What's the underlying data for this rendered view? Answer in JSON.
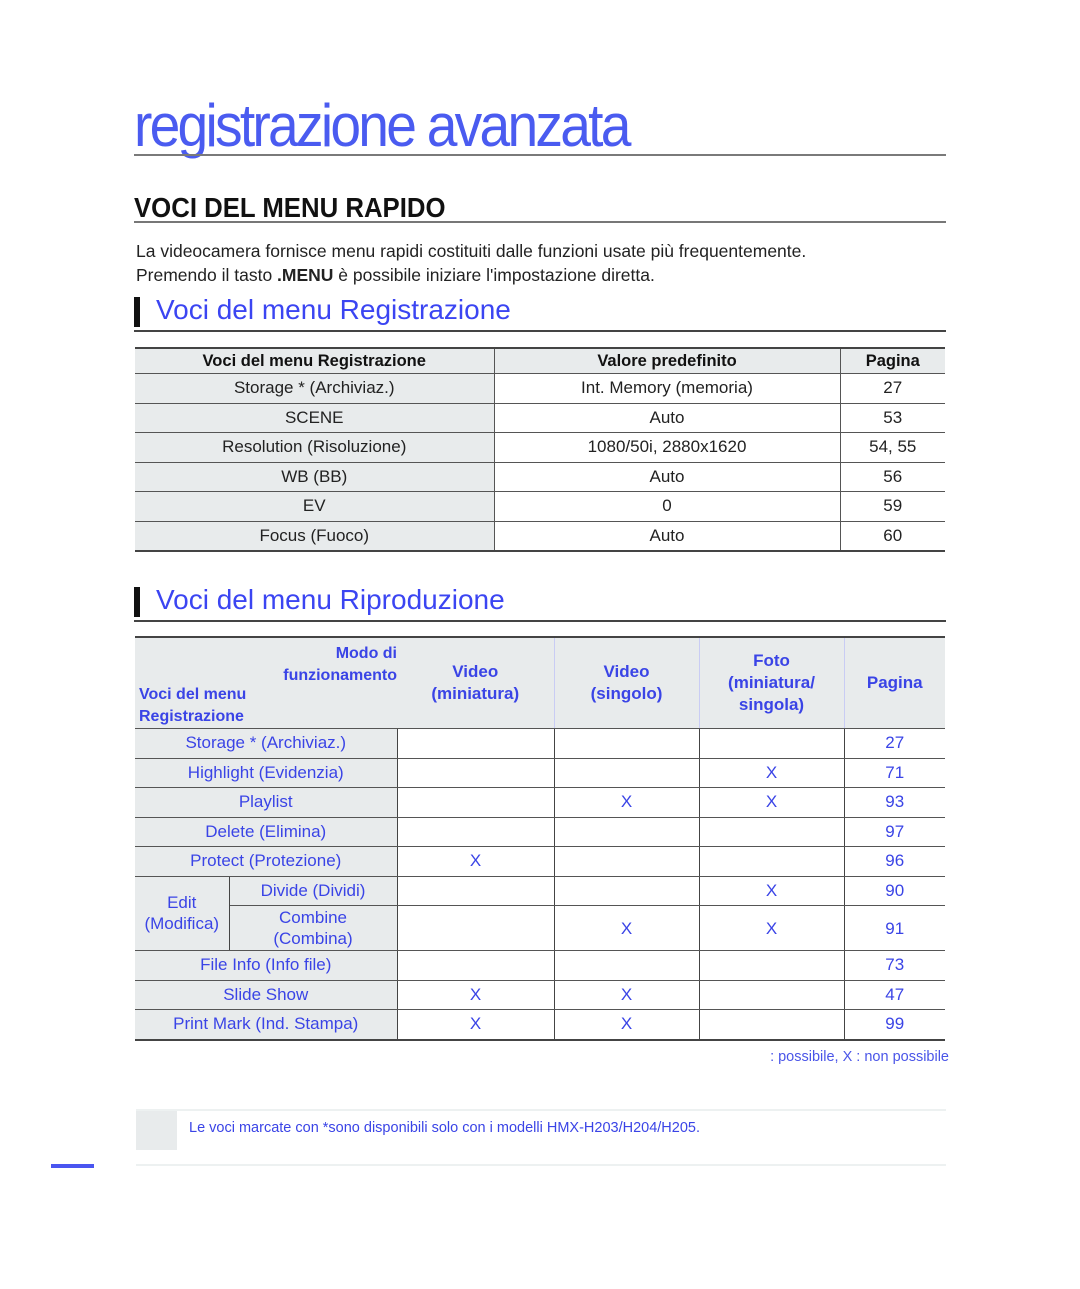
{
  "chapter_title": "registrazione avanzata",
  "section_title": "VOCI DEL MENU RAPIDO",
  "intro": {
    "line1": "La videocamera fornisce menu rapidi costituiti dalle funzioni usate più frequentemente.",
    "line2_pre": "Premendo il tasto ",
    "line2_key": ".MENU",
    "line2_post": " è possibile iniziare l'impostazione diretta."
  },
  "recording": {
    "heading": "Voci del menu Registrazione",
    "columns": [
      "Voci del menu Registrazione",
      "Valore predefinito",
      "Pagina"
    ],
    "rows": [
      {
        "item": "Storage * (Archiviaz.)",
        "default": "Int. Memory (memoria)",
        "page": "27"
      },
      {
        "item": "SCENE",
        "default": "Auto",
        "page": "53"
      },
      {
        "item": "Resolution (Risoluzione)",
        "default": "1080/50i, 2880x1620",
        "page": "54, 55"
      },
      {
        "item": "WB (BB)",
        "default": "Auto",
        "page": "56"
      },
      {
        "item": "EV",
        "default": "0",
        "page": "59"
      },
      {
        "item": "Focus (Fuoco)",
        "default": "Auto",
        "page": "60"
      }
    ]
  },
  "playback": {
    "heading": "Voci del menu Riproduzione",
    "header": {
      "mode_line1": "Modo di",
      "mode_line2": "funzionamento",
      "items_line1": "Voci del menu",
      "items_line2": "Registrazione",
      "video_thumb_1": "Video",
      "video_thumb_2": "(miniatura)",
      "video_single_1": "Video",
      "video_single_2": "(singolo)",
      "photo_1": "Foto",
      "photo_2": "(miniatura/",
      "photo_3": "singola)",
      "page": "Pagina"
    },
    "rows": [
      {
        "item": "Storage * (Archiviaz.)",
        "video_thumb": "",
        "video_single": "",
        "photo": "",
        "page": "27"
      },
      {
        "item": "Highlight (Evidenzia)",
        "video_thumb": "",
        "video_single": "",
        "photo": "X",
        "page": "71"
      },
      {
        "item": "Playlist",
        "video_thumb": "",
        "video_single": "X",
        "photo": "X",
        "page": "93"
      },
      {
        "item": "Delete (Elimina)",
        "video_thumb": "",
        "video_single": "",
        "photo": "",
        "page": "97"
      },
      {
        "item": "Protect (Protezione)",
        "video_thumb": "X",
        "video_single": "",
        "photo": "",
        "page": "96"
      }
    ],
    "edit_group": {
      "label_1": "Edit",
      "label_2": "(Modifica)",
      "rows": [
        {
          "item": "Divide (Dividi)",
          "video_thumb": "",
          "video_single": "",
          "photo": "X",
          "page": "90"
        },
        {
          "item_1": "Combine",
          "item_2": "(Combina)",
          "video_thumb": "",
          "video_single": "X",
          "photo": "X",
          "page": "91"
        }
      ]
    },
    "rows_after": [
      {
        "item": "File Info (Info file)",
        "video_thumb": "",
        "video_single": "",
        "photo": "",
        "page": "73"
      },
      {
        "item": "Slide Show",
        "video_thumb": "X",
        "video_single": "X",
        "photo": "",
        "page": "47"
      },
      {
        "item": "Print Mark (Ind. Stampa)",
        "video_thumb": "X",
        "video_single": "X",
        "photo": "",
        "page": "99"
      }
    ],
    "legend": ": possibile, X : non possibile"
  },
  "note": "Le voci marcate con *sono disponibili solo con i modelli HMX-H203/H204/H205.",
  "colors": {
    "accent_blue": "#3a44e6",
    "header_gray": "#e8ebec"
  }
}
